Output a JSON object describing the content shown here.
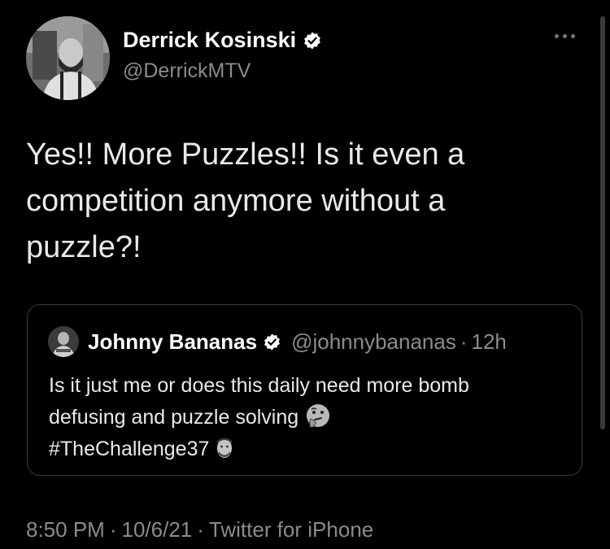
{
  "tweet": {
    "author": {
      "display_name": "Derrick Kosinski",
      "handle": "@DerrickMTV",
      "verified": true,
      "avatar": "profile-photo"
    },
    "text": "Yes!! More Puzzles!! Is it even a competition anymore without a puzzle?!",
    "more_icon": "ellipsis-icon",
    "quoted_tweet": {
      "display_name": "Johnny Bananas",
      "handle": "@johnnybananas",
      "separator": "·",
      "time": "12h",
      "verified": true,
      "line1": "Is it just me or does this daily need more bomb",
      "line2": "defusing and puzzle solving",
      "line2_emoji": "thinking-face-emoji",
      "line3": "#TheChallenge37",
      "line3_emoji": "face-emoji"
    },
    "meta": {
      "time": "8:50 PM",
      "separator": "·",
      "date": "10/6/21",
      "source": "Twitter for iPhone"
    }
  },
  "colors": {
    "background": "#000000",
    "text": "#e7e9ea",
    "secondary_text": "#8b8b8b",
    "border": "#3a3a3a",
    "verified_badge": "#ffffff"
  }
}
